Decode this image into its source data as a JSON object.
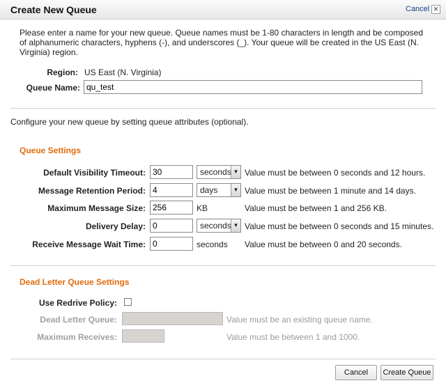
{
  "dialog": {
    "title": "Create New Queue",
    "cancel_link": "Cancel",
    "close_glyph": "✕"
  },
  "intro": "Please enter a name for your new queue. Queue names must be 1-80 characters in length and be composed of alphanumeric characters, hyphens (-), and underscores (_). Your queue will be created in the US East (N. Virginia) region.",
  "region": {
    "label": "Region:",
    "value": "US East (N. Virginia)"
  },
  "queue_name": {
    "label": "Queue Name:",
    "value": "qu_test"
  },
  "configure_text": "Configure your new queue by setting queue attributes (optional).",
  "queue_settings": {
    "heading": "Queue Settings",
    "rows": [
      {
        "label": "Default Visibility Timeout:",
        "value": "30",
        "unit": "seconds",
        "hint": "Value must be between 0 seconds and 12 hours."
      },
      {
        "label": "Message Retention Period:",
        "value": "4",
        "unit": "days",
        "hint": "Value must be between 1 minute and 14 days."
      },
      {
        "label": "Maximum Message Size:",
        "value": "256",
        "unit": "KB",
        "hint": "Value must be between 1 and 256 KB."
      },
      {
        "label": "Delivery Delay:",
        "value": "0",
        "unit": "seconds",
        "hint": "Value must be between 0 seconds and 15 minutes."
      },
      {
        "label": "Receive Message Wait Time:",
        "value": "0",
        "unit": "seconds",
        "hint": "Value must be between 0 and 20 seconds."
      }
    ]
  },
  "dlq_settings": {
    "heading": "Dead Letter Queue Settings",
    "use_redrive_label": "Use Redrive Policy:",
    "dead_letter_queue_label": "Dead Letter Queue:",
    "dead_letter_queue_hint": "Value must be an existing queue name.",
    "max_receives_label": "Maximum Receives:",
    "max_receives_hint": "Value must be between 1 and 1000."
  },
  "footer": {
    "cancel": "Cancel",
    "create": "Create Queue"
  },
  "icons": {
    "dropdown_arrow": "▼"
  }
}
